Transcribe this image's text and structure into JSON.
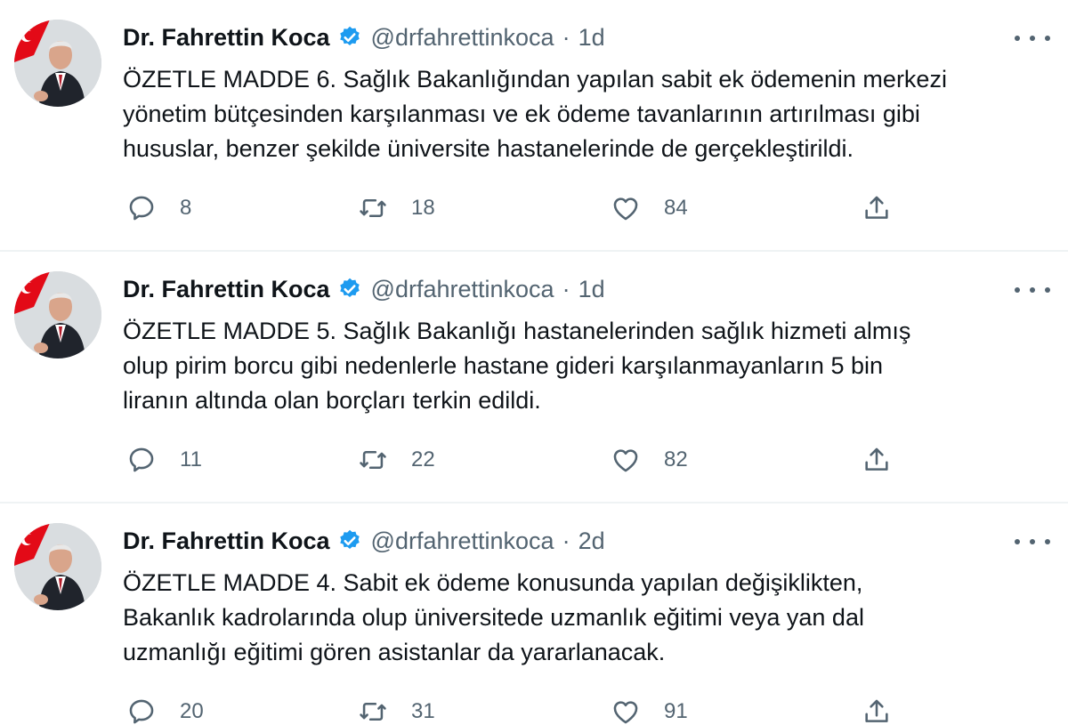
{
  "tweets": [
    {
      "author_name": "Dr. Fahrettin Koca",
      "handle": "@drfahrettinkoca",
      "separator": "·",
      "time": "1d",
      "text": "ÖZETLE MADDE 6. Sağlık Bakanlığından yapılan sabit ek ödemenin merkezi\nyönetim bütçesinden karşılanması ve ek ödeme tavanlarının artırılması gibi\nhususlar, benzer şekilde üniversite hastanelerinde de gerçekleştirildi.",
      "replies": "8",
      "retweets": "18",
      "likes": "84"
    },
    {
      "author_name": "Dr. Fahrettin Koca",
      "handle": "@drfahrettinkoca",
      "separator": "·",
      "time": "1d",
      "text": "ÖZETLE MADDE 5. Sağlık Bakanlığı hastanelerinden sağlık hizmeti almış\nolup pirim borcu gibi nedenlerle hastane gideri karşılanmayanların 5 bin\nliranın altında olan borçları terkin edildi.",
      "replies": "11",
      "retweets": "22",
      "likes": "82"
    },
    {
      "author_name": "Dr. Fahrettin Koca",
      "handle": "@drfahrettinkoca",
      "separator": "·",
      "time": "2d",
      "text": "ÖZETLE MADDE 4. Sabit ek ödeme konusunda yapılan değişiklikten,\nBakanlık kadrolarında olup üniversitede uzmanlık eğitimi veya yan dal\nuzmanlığı eğitimi gören asistanlar da yararlanacak.",
      "replies": "20",
      "retweets": "31",
      "likes": "91"
    }
  ],
  "icons": {
    "verified": "verified-badge-icon",
    "more": "more-options-icon",
    "reply": "reply-icon",
    "retweet": "retweet-icon",
    "like": "like-icon",
    "share": "share-icon"
  },
  "colors": {
    "verified_blue": "#1d9bf0",
    "secondary_text": "#536471",
    "primary_text": "#0f1419",
    "divider": "#eff3f4"
  }
}
